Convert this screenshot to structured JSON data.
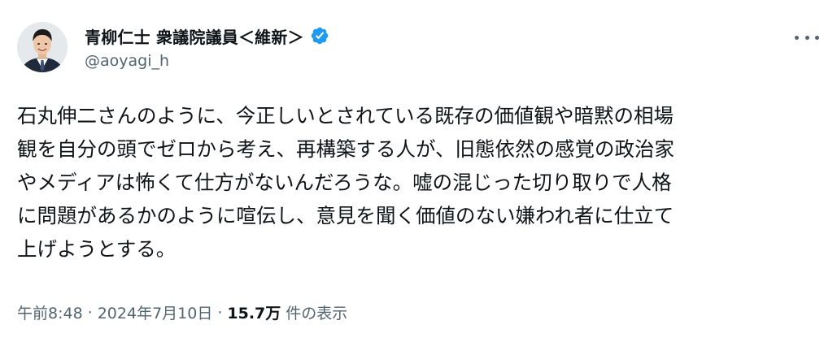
{
  "author": {
    "display_name": "青柳仁士 衆議院議員＜維新＞",
    "handle": "@aoyagi_h",
    "verified": true,
    "avatar_icon": "person-photo-avatar",
    "verified_icon": "verified-check-badge",
    "verified_color": "#1d9bf0"
  },
  "menu": {
    "more_icon": "more-horizontal-icon"
  },
  "tweet": {
    "text": "石丸伸二さんのように、今正しいとされている既存の価値観や暗黙の相場\n観を自分の頭でゼロから考え、再構築する人が、旧態依然の感覚の政治家\nやメディアは怖くて仕方がないんだろうな。嘘の混じった切り取りで人格\nに問題があるかのように喧伝し、意見を聞く価値のない嫌われ者に仕立て\n上げようとする。"
  },
  "meta": {
    "time": "午前8:48",
    "separator": "·",
    "date": "2024年7月10日",
    "views_count": "15.7万",
    "views_label": "件の表示"
  },
  "colors": {
    "text": "#0f1419",
    "secondary": "#536471",
    "accent": "#1d9bf0"
  }
}
